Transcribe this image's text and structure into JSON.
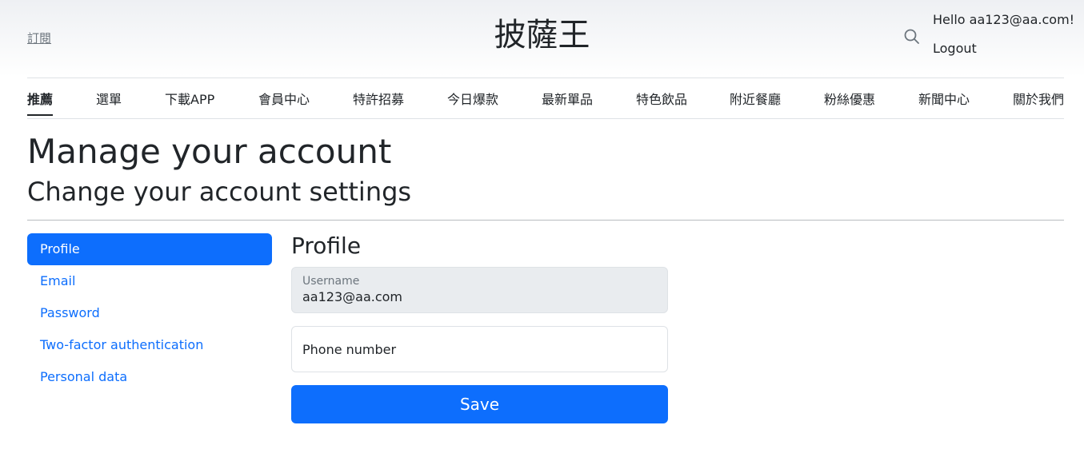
{
  "header": {
    "subscribe_label": "訂閱",
    "brand": "披薩王",
    "greeting": "Hello aa123@aa.com!",
    "logout_label": "Logout",
    "search_icon": "search-icon"
  },
  "nav": {
    "items": [
      {
        "label": "推薦",
        "active": true
      },
      {
        "label": "選單"
      },
      {
        "label": "下載APP"
      },
      {
        "label": "會員中心"
      },
      {
        "label": "特許招募"
      },
      {
        "label": "今日爆款"
      },
      {
        "label": "最新單品"
      },
      {
        "label": "特色飲品"
      },
      {
        "label": "附近餐廳"
      },
      {
        "label": "粉絲優惠"
      },
      {
        "label": "新聞中心"
      },
      {
        "label": "關於我們"
      }
    ]
  },
  "page": {
    "title": "Manage your account",
    "subtitle": "Change your account settings"
  },
  "sidebar": {
    "items": [
      {
        "label": "Profile",
        "active": true
      },
      {
        "label": "Email"
      },
      {
        "label": "Password"
      },
      {
        "label": "Two-factor authentication"
      },
      {
        "label": "Personal data"
      }
    ]
  },
  "profile": {
    "heading": "Profile",
    "username_label": "Username",
    "username_value": "aa123@aa.com",
    "phone_placeholder": "Phone number",
    "save_label": "Save"
  },
  "colors": {
    "primary": "#0d6efd",
    "disabled_field": "#e9ecef",
    "text": "#212529"
  }
}
